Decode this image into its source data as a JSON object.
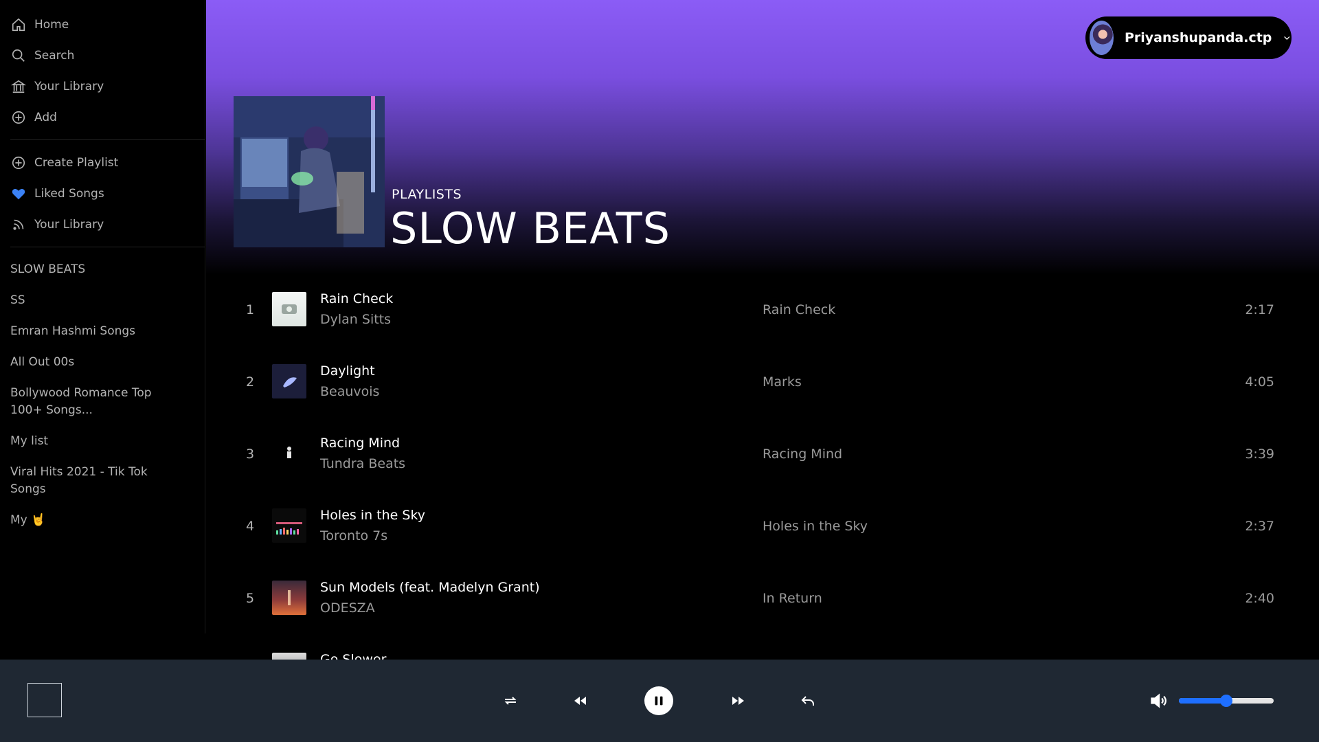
{
  "sidebar": {
    "nav": [
      {
        "label": "Home",
        "icon": "home-icon"
      },
      {
        "label": "Search",
        "icon": "search-icon"
      },
      {
        "label": "Your Library",
        "icon": "library-icon"
      },
      {
        "label": "Add",
        "icon": "add-icon"
      }
    ],
    "nav2": [
      {
        "label": "Create Playlist",
        "icon": "plus-circle-icon"
      },
      {
        "label": "Liked Songs",
        "icon": "heart-icon"
      },
      {
        "label": "Your Library",
        "icon": "rss-icon"
      }
    ],
    "playlists": [
      "SLOW BEATS",
      "SS",
      "Emran Hashmi Songs",
      "All Out 00s",
      "Bollywood Romance Top 100+ Songs...",
      "My list",
      "Viral Hits 2021 - Tik Tok Songs",
      "My 🤘"
    ]
  },
  "user": {
    "name": "Priyanshupanda.ctp"
  },
  "hero": {
    "label": "PLAYLISTS",
    "title": "SLOW BEATS"
  },
  "tracks": [
    {
      "num": "1",
      "title": "Rain Check",
      "artist": "Dylan Sitts",
      "album": "Rain Check",
      "duration": "2:17"
    },
    {
      "num": "2",
      "title": "Daylight",
      "artist": "Beauvois",
      "album": "Marks",
      "duration": "4:05"
    },
    {
      "num": "3",
      "title": "Racing Mind",
      "artist": "Tundra Beats",
      "album": "Racing Mind",
      "duration": "3:39"
    },
    {
      "num": "4",
      "title": "Holes in the Sky",
      "artist": "Toronto 7s",
      "album": "Holes in the Sky",
      "duration": "2:37"
    },
    {
      "num": "5",
      "title": "Sun Models (feat. Madelyn Grant)",
      "artist": "ODESZA",
      "album": "In Return",
      "duration": "2:40"
    },
    {
      "num": "",
      "title": "Go Slower",
      "artist": "",
      "album": "",
      "duration": ""
    }
  ],
  "player": {
    "volume_fraction": 0.5,
    "accent": "#1e6fff",
    "bar_color": "#1f2833"
  },
  "colors": {
    "hero_top": "#8b5cf6",
    "muted_text": "#9a9a9a"
  }
}
